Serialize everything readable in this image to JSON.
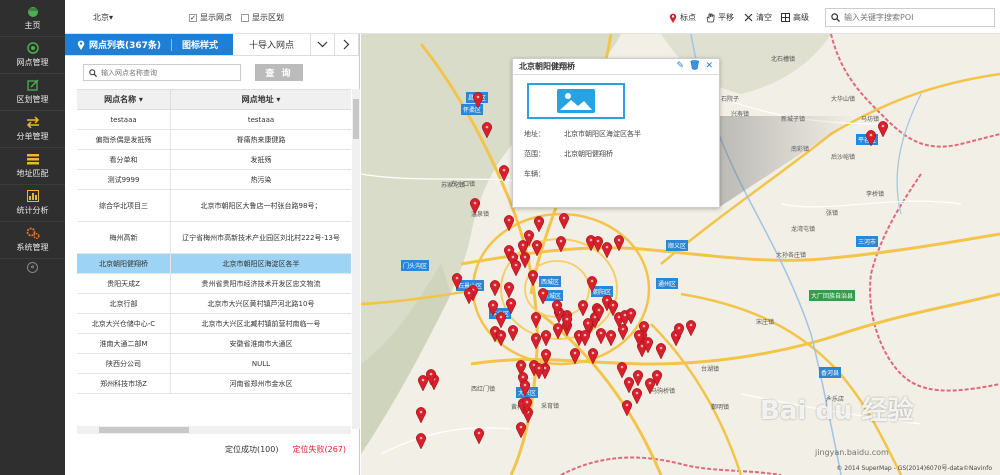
{
  "nav": [
    {
      "label": "主页",
      "icon": "home-icon"
    },
    {
      "label": "网点管理",
      "icon": "target-icon"
    },
    {
      "label": "区划管理",
      "icon": "edit-icon"
    },
    {
      "label": "分单管理",
      "icon": "transfer-icon"
    },
    {
      "label": "地址匹配",
      "icon": "list-icon"
    },
    {
      "label": "统计分析",
      "icon": "bar-chart-icon"
    },
    {
      "label": "系统管理",
      "icon": "gears-icon"
    }
  ],
  "nav_collapse": "«",
  "topbar": {
    "city": "北京▾",
    "show_points": "显示网点",
    "show_regions": "显示区划",
    "tools": {
      "mark": "标点",
      "pan": "平移",
      "clear": "清空",
      "advanced": "高级"
    },
    "search_placeholder": "输入关键字搜索POI"
  },
  "panel": {
    "tab_list": "网点列表(367条)",
    "tab_icon_style": "图标样式",
    "tab_import": "十导入网点",
    "search_placeholder": "输入网点名称查询",
    "query_button": "查 询",
    "col_name": "网点名称 ▾",
    "col_address": "网点地址 ▾",
    "rows": [
      {
        "name": "testaaa",
        "address": "testaaa"
      },
      {
        "name": "偏指杀偶是发抵殇",
        "address": "脊痛热来康健路"
      },
      {
        "name": "看分单和",
        "address": "发抵殇"
      },
      {
        "name": "测试9999",
        "address": "热污染"
      },
      {
        "name": "综合华北项目三",
        "address": "北京市朝阳区大鲁店一村张台路98号；"
      },
      {
        "name": "梅州高新",
        "address": "辽宁省梅州市高新技术产业园区刘北村222号-13号"
      },
      {
        "name": "北京朝阳健翔桥",
        "address": "北京市朝阳区海淀区各半"
      },
      {
        "name": "贵阳天成Z",
        "address": "贵州省贵阳市经济技术开发区忠文物流"
      },
      {
        "name": "北京行部",
        "address": "北京市大兴区黄村镇芦河北路10号"
      },
      {
        "name": "北京大兴仓储中心-C",
        "address": "北京市大兴区北臧村镇前营村南临一号"
      },
      {
        "name": "淮南大通二部M",
        "address": "安徽省淮南市大通区"
      },
      {
        "name": "陕西分公司",
        "address": "NULL"
      },
      {
        "name": "郑州科技市场Z",
        "address": "河南省郑州市金水区"
      }
    ],
    "selected_index": 6,
    "footer_success": "定位成功(100)",
    "footer_fail": "定位失败(267)"
  },
  "popup": {
    "title": "北京朝阳健翔桥",
    "address_label": "地址：",
    "address_value": "北京市朝阳区海淀区各半",
    "range_label": "范围：",
    "range_value": "北京朝阳健翔桥",
    "vehicle_label": "车辆："
  },
  "map_tags": [
    {
      "t": "怀柔区",
      "c": "blue"
    },
    {
      "t": "平谷区",
      "c": "blue"
    },
    {
      "t": "昌平区",
      "c": "blue"
    },
    {
      "t": "顺义区",
      "c": "blue"
    },
    {
      "t": "门头沟区",
      "c": "blue"
    },
    {
      "t": "石景山区",
      "c": "blue"
    },
    {
      "t": "西城区",
      "c": "blue"
    },
    {
      "t": "东城区",
      "c": "blue"
    },
    {
      "t": "丰台区",
      "c": "blue"
    },
    {
      "t": "朝阳区",
      "c": "blue"
    },
    {
      "t": "通州区",
      "c": "blue"
    },
    {
      "t": "大兴区",
      "c": "blue"
    },
    {
      "t": "三河市",
      "c": "blue"
    },
    {
      "t": "大厂回族自治县",
      "c": "green"
    },
    {
      "t": "香河县",
      "c": "blue"
    }
  ],
  "map_places": [
    "北石槽镇",
    "石院子",
    "兴寿镇",
    "东小口镇",
    "苏家坨镇",
    "温泉镇",
    "李桥镇",
    "张镇",
    "龙湾屯镇",
    "大孙各庄镇",
    "宋庄镇",
    "永乐店",
    "采育镇",
    "黄村镇",
    "西红门镇",
    "马驹桥镇",
    "台湖镇",
    "鄞明镇",
    "新城子镇",
    "大华山镇",
    "马坊镇",
    "南彩镇",
    "后沙峪镇"
  ],
  "credit": "© 2014 SuperMap - GS(2014)6070号-data©Navinfo",
  "watermark": "Bai du 经验",
  "watermark_url": "jingyan.baidu.com",
  "colors": {
    "accent": "#1f7fd6",
    "nav_bg": "#2f2f2f",
    "selected_row": "#9dd3f5",
    "marker": "#d8202c",
    "fail": "#dd2233"
  }
}
